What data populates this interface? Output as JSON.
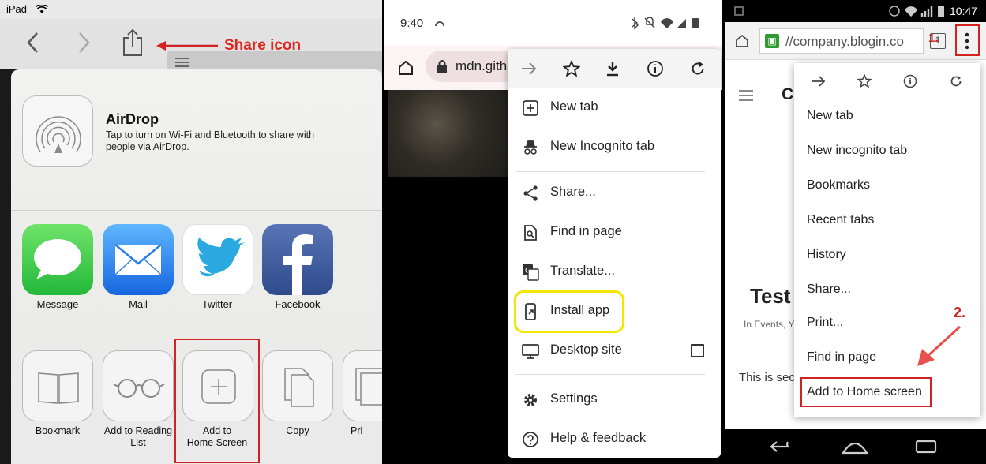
{
  "ipad": {
    "status": {
      "device": "iPad"
    },
    "annotation": {
      "share_label": "Share icon"
    },
    "airdrop": {
      "title": "AirDrop",
      "description_line1": "Tap to turn on Wi-Fi and Bluetooth to share with",
      "description_line2": "people via AirDrop."
    },
    "apps": [
      {
        "label": "Message",
        "icon": "messages-icon",
        "color": "#3ecf4a"
      },
      {
        "label": "Mail",
        "icon": "mail-icon",
        "color": "#1e7cf2"
      },
      {
        "label": "Twitter",
        "icon": "twitter-icon",
        "color": "#2aa9e0"
      },
      {
        "label": "Facebook",
        "icon": "facebook-icon",
        "color": "#3b5998"
      }
    ],
    "actions": [
      {
        "line1": "Bookmark",
        "line2": "",
        "icon": "book-icon"
      },
      {
        "line1": "Add to Reading",
        "line2": "List",
        "icon": "glasses-icon"
      },
      {
        "line1": "Add to",
        "line2": "Home Screen",
        "icon": "plus-icon"
      },
      {
        "line1": "Copy",
        "line2": "",
        "icon": "copy-icon"
      },
      {
        "line1": "Pri",
        "line2": "",
        "icon": "print-icon"
      }
    ]
  },
  "android": {
    "status": {
      "time": "9:40"
    },
    "url": "mdn.gith",
    "menu": {
      "items": [
        {
          "label": "New tab",
          "icon": "plus-box-icon"
        },
        {
          "label": "New Incognito tab",
          "icon": "incognito-icon"
        },
        {
          "label": "Share...",
          "icon": "share-icon"
        },
        {
          "label": "Find in page",
          "icon": "find-icon"
        },
        {
          "label": "Translate...",
          "icon": "translate-icon"
        },
        {
          "label": "Install app",
          "icon": "install-icon"
        },
        {
          "label": "Desktop site",
          "icon": "desktop-icon"
        },
        {
          "label": "Settings",
          "icon": "gear-icon"
        },
        {
          "label": "Help & feedback",
          "icon": "help-icon"
        }
      ]
    },
    "highlight_color": "#f3e600"
  },
  "old_android": {
    "status": {
      "time": "10:47"
    },
    "url": "//company.blogin.co",
    "tab_count": "1",
    "page": {
      "heading": "Test",
      "heading_partial_c": "Co",
      "meta": "In Events, Y",
      "meta_link": "Events",
      "body": "This is seco"
    },
    "annotations": {
      "step1": "1.",
      "step2": "2."
    },
    "menu": {
      "items": [
        "New tab",
        "New incognito tab",
        "Bookmarks",
        "Recent tabs",
        "History",
        "Share...",
        "Print...",
        "Find in page",
        "Add to Home screen"
      ]
    },
    "accent_red": "#d32222"
  }
}
